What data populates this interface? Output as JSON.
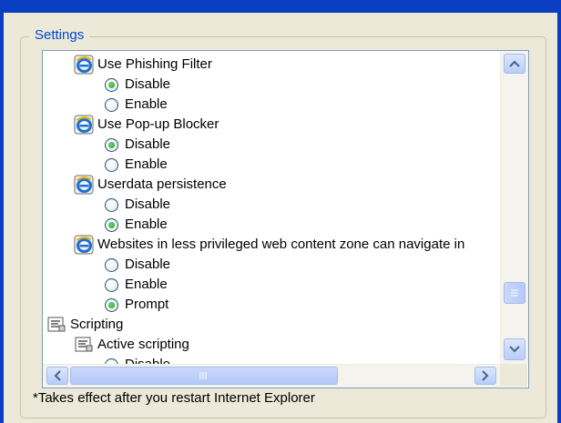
{
  "group": {
    "title": "Settings"
  },
  "rows": [
    {
      "kind": "category",
      "label": "Use Phishing Filter",
      "icon": "ie-icon"
    },
    {
      "kind": "option",
      "label": "Disable",
      "checked": true
    },
    {
      "kind": "option",
      "label": "Enable",
      "checked": false
    },
    {
      "kind": "category",
      "label": "Use Pop-up Blocker",
      "icon": "ie-icon"
    },
    {
      "kind": "option",
      "label": "Disable",
      "checked": true
    },
    {
      "kind": "option",
      "label": "Enable",
      "checked": false
    },
    {
      "kind": "category",
      "label": "Userdata persistence",
      "icon": "ie-icon"
    },
    {
      "kind": "option",
      "label": "Disable",
      "checked": false
    },
    {
      "kind": "option",
      "label": "Enable",
      "checked": true
    },
    {
      "kind": "category",
      "label": "Websites in less privileged web content zone can navigate in",
      "icon": "ie-icon"
    },
    {
      "kind": "option",
      "label": "Disable",
      "checked": false
    },
    {
      "kind": "option",
      "label": "Enable",
      "checked": false
    },
    {
      "kind": "option",
      "label": "Prompt",
      "checked": true
    },
    {
      "kind": "group",
      "label": "Scripting",
      "icon": "script-icon"
    },
    {
      "kind": "category",
      "label": "Active scripting",
      "icon": "script-icon"
    },
    {
      "kind": "option",
      "label": "Disable",
      "checked": false
    }
  ],
  "footnote": "*Takes effect after you restart Internet Explorer",
  "colors": {
    "window_frame": "#0a3fc4",
    "dialog_bg": "#ece9d8",
    "legend_text": "#0046d5",
    "radio_checked": "#21a121"
  }
}
